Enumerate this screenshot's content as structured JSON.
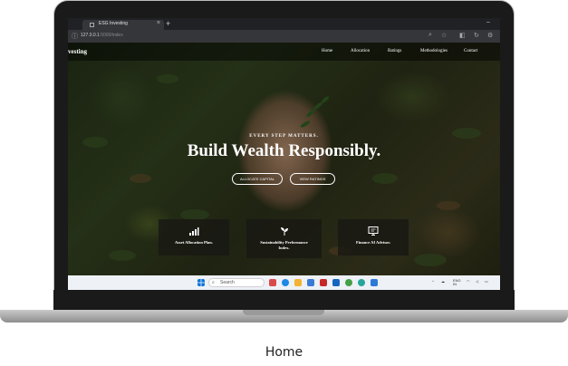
{
  "browser": {
    "tab_title": "ESG Investing",
    "tab_close": "×",
    "new_tab": "+",
    "url_host": "127.0.0.1",
    "url_path": ":5000/index",
    "minimize": "–"
  },
  "site": {
    "brand": "vesting",
    "nav": [
      "Home",
      "Allocation",
      "Ratings",
      "Methodologies",
      "Contact"
    ],
    "tagline": "EVERY STEP MATTERS.",
    "headline": "Build Wealth Responsibly.",
    "buttons": {
      "allocate": "ALLOCATE CAPITAL",
      "ratings": "VIEW RATINGS"
    },
    "cards": [
      {
        "icon": "bar-chart-icon",
        "label": "Asset Allocation Plan."
      },
      {
        "icon": "sprout-icon",
        "label": "Sustainability Performance Index."
      },
      {
        "icon": "monitor-chat-icon",
        "label": "Finance AI Advisor."
      }
    ]
  },
  "taskbar": {
    "search_placeholder": "Search",
    "lang_top": "ENG",
    "lang_bottom": "IN"
  },
  "caption": "Home",
  "colors": {
    "accent": "#ffffff",
    "nav_bg": "#000000",
    "taskbar_bg": "#eef1f6"
  }
}
